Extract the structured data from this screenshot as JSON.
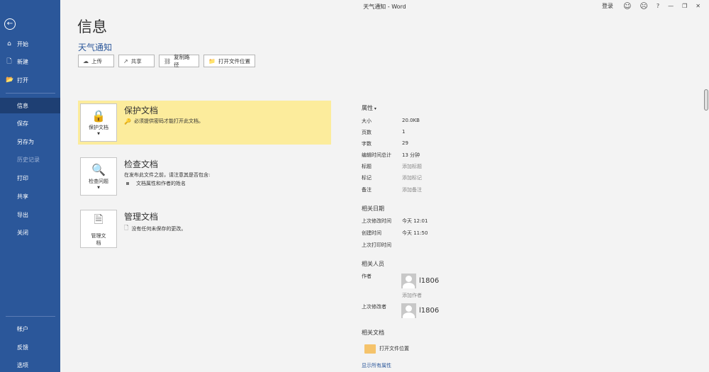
{
  "window": {
    "title": "天气通知 - Word",
    "login_label": "登录",
    "smile_icon": "☺",
    "frown_icon": "☹",
    "help_label": "?",
    "minimize_icon": "—",
    "restore_icon": "❐",
    "close_icon": "✕"
  },
  "sidebar": {
    "back_icon": "←",
    "items": [
      {
        "label": "开始",
        "icon": "⌂"
      },
      {
        "label": "新建",
        "icon": "🗋"
      },
      {
        "label": "打开",
        "icon": "📂"
      },
      {
        "label": "信息"
      },
      {
        "label": "保存"
      },
      {
        "label": "另存为"
      },
      {
        "label": "历史记录"
      },
      {
        "label": "打印"
      },
      {
        "label": "共享"
      },
      {
        "label": "导出"
      },
      {
        "label": "关闭"
      }
    ],
    "bottom_items": [
      {
        "label": "帐户"
      },
      {
        "label": "反馈"
      },
      {
        "label": "选项"
      }
    ]
  },
  "main": {
    "page_title": "信息",
    "doc_name": "天气通知",
    "actions": [
      {
        "label": "上传",
        "icon": "☁"
      },
      {
        "label": "共享",
        "icon": "↗"
      },
      {
        "label": "复制路径",
        "icon": "⛓"
      },
      {
        "label": "打开文件位置",
        "icon": "📁"
      }
    ],
    "panels": [
      {
        "button_label": "保护文档",
        "button_icon": "🔒",
        "title": "保护文档",
        "desc": "必须提供密码才能打开此文档。",
        "desc_icon": "🔑"
      },
      {
        "button_label": "检查问题",
        "button_icon": "🔍",
        "title": "检查文档",
        "desc": "在发布此文件之前，请注意其是否包含:",
        "bullet": "文档属性和作者的姓名"
      },
      {
        "button_label_line1": "管理文",
        "button_label_line2": "档",
        "button_icon": "🗎",
        "title": "管理文档",
        "desc": "没有任何未保存的更改。",
        "desc_icon": "🗋"
      }
    ]
  },
  "properties": {
    "title": "属性",
    "rows": [
      {
        "key": "大小",
        "value": "20.0KB"
      },
      {
        "key": "页数",
        "value": "1"
      },
      {
        "key": "字数",
        "value": "29"
      },
      {
        "key": "编辑时间总计",
        "value": "13 分钟"
      },
      {
        "key": "标题",
        "value": "添加标题"
      },
      {
        "key": "标记",
        "value": "添加标记"
      },
      {
        "key": "备注",
        "value": "添加备注"
      }
    ],
    "dates_title": "相关日期",
    "dates": [
      {
        "key": "上次修改时间",
        "value": "今天 12:01"
      },
      {
        "key": "创建时间",
        "value": "今天 11:50"
      },
      {
        "key": "上次打印时间",
        "value": ""
      }
    ],
    "people_title": "相关人员",
    "author_label": "作者",
    "author_name": "l1806",
    "add_author": "添加作者",
    "last_modified_by_label": "上次修改者",
    "last_modified_by_name": "l1806",
    "docs_title": "相关文档",
    "open_location": "打开文件位置",
    "show_all": "显示所有属性"
  }
}
